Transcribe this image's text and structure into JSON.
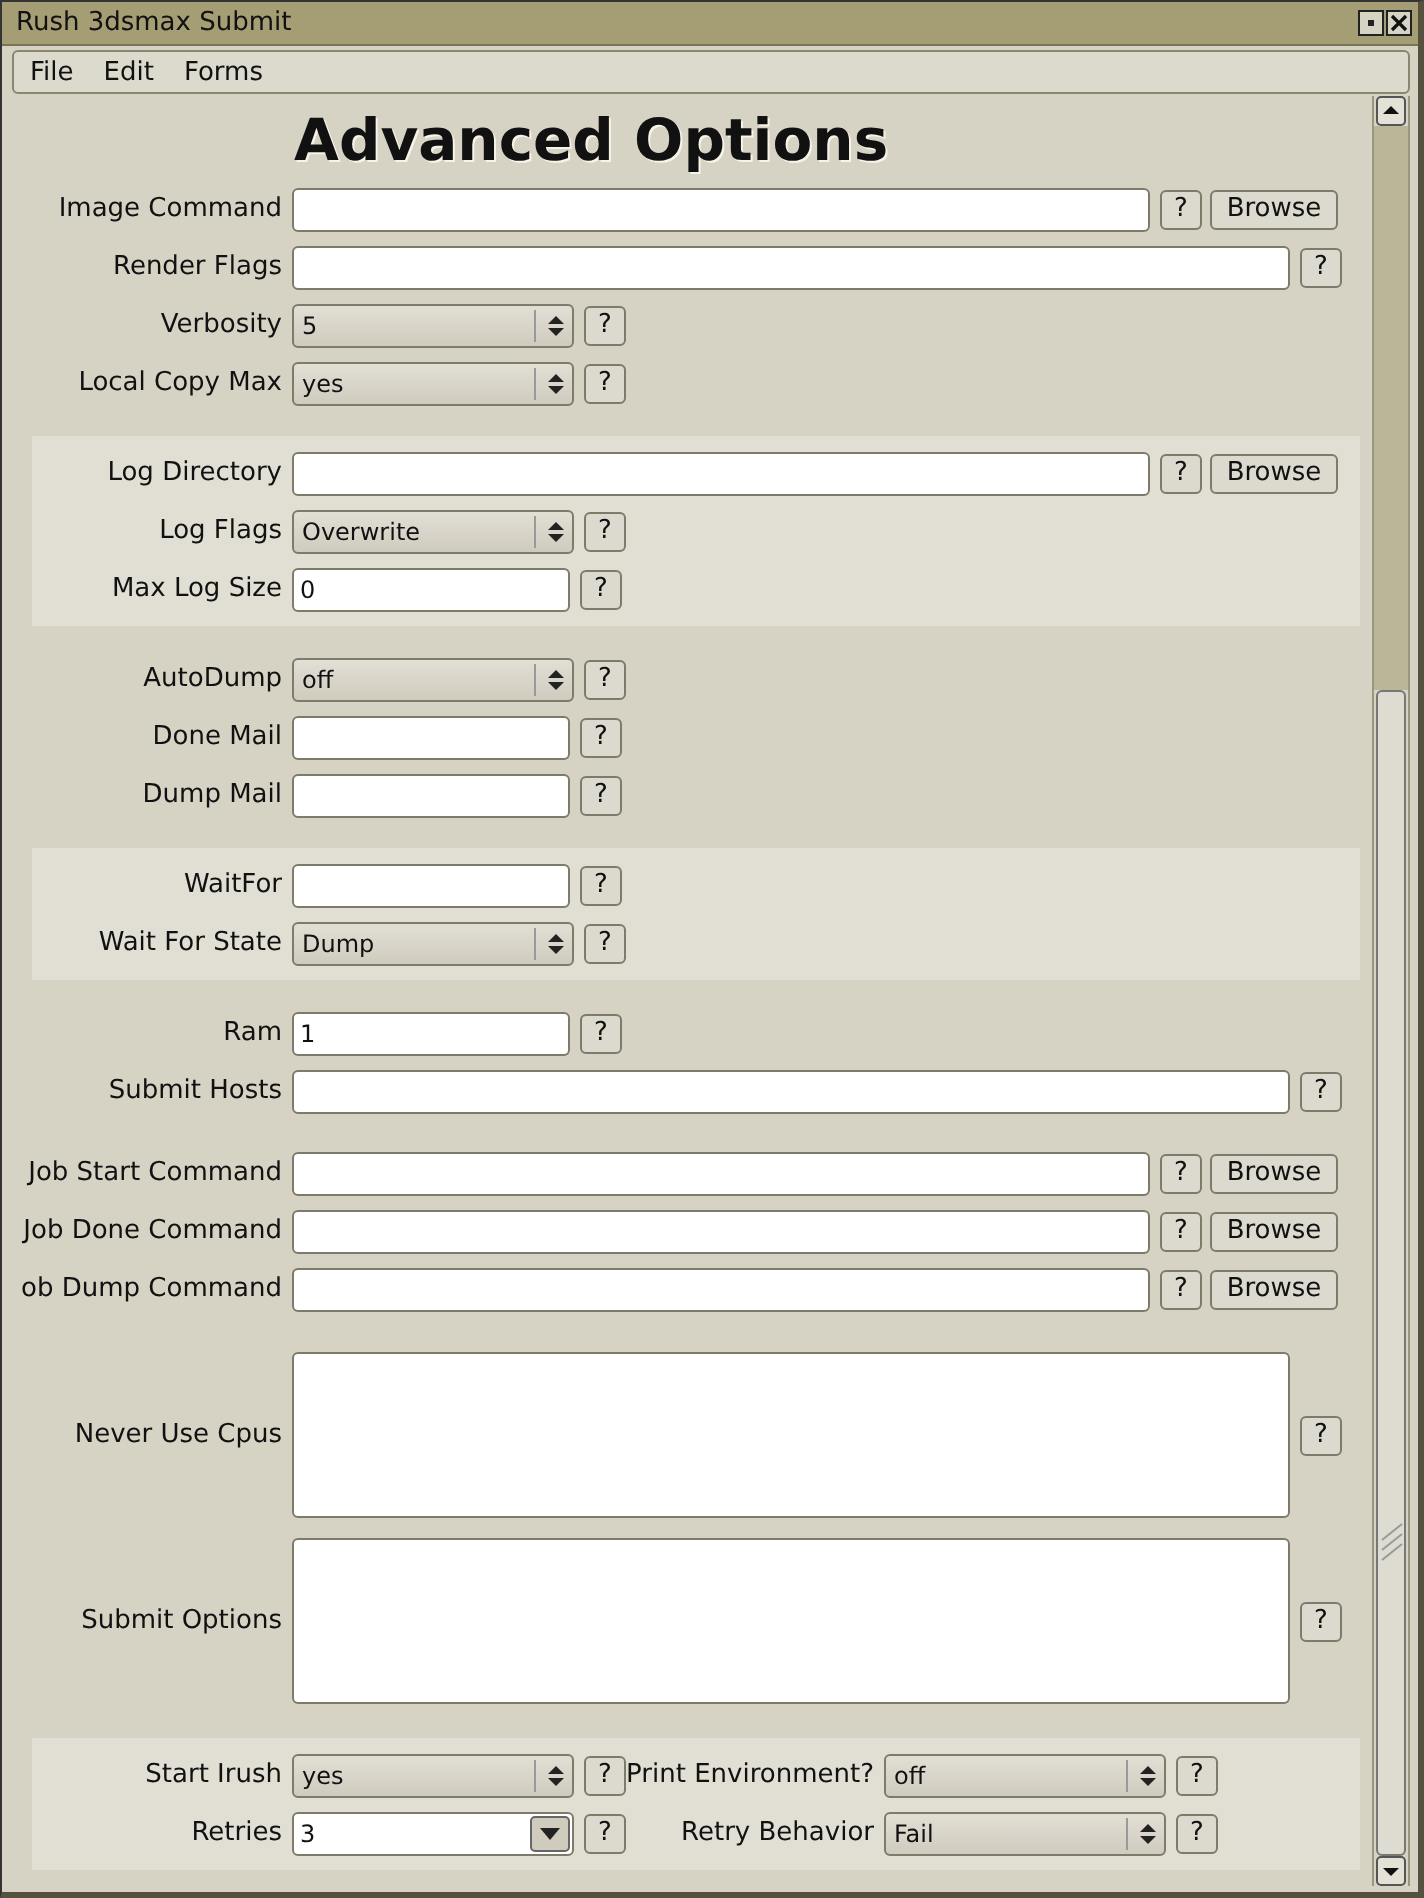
{
  "window": {
    "title": "Rush 3dsmax Submit"
  },
  "menu": [
    {
      "label": "File"
    },
    {
      "label": "Edit"
    },
    {
      "label": "Forms"
    }
  ],
  "heading": "Advanced Options",
  "sections": [
    {
      "shaded": false,
      "rows": [
        {
          "kind": "path",
          "label": "Image Command",
          "help": "?",
          "browse": "Browse"
        },
        {
          "kind": "wide",
          "label": "Render Flags",
          "help": "?"
        },
        {
          "kind": "select",
          "label": "Verbosity",
          "value": "5",
          "help": "?"
        },
        {
          "kind": "select",
          "label": "Local Copy Max",
          "value": "yes",
          "help": "?"
        }
      ]
    },
    {
      "shaded": true,
      "rows": [
        {
          "kind": "path",
          "label": "Log Directory",
          "help": "?",
          "browse": "Browse"
        },
        {
          "kind": "select",
          "label": "Log Flags",
          "value": "Overwrite",
          "help": "?"
        },
        {
          "kind": "text",
          "label": "Max Log Size",
          "value": "0",
          "help": "?"
        }
      ]
    },
    {
      "shaded": false,
      "rows": [
        {
          "kind": "select",
          "label": "AutoDump",
          "value": "off",
          "help": "?"
        },
        {
          "kind": "text",
          "label": "Done Mail",
          "help": "?"
        },
        {
          "kind": "text",
          "label": "Dump Mail",
          "help": "?"
        }
      ]
    },
    {
      "shaded": true,
      "rows": [
        {
          "kind": "text",
          "label": "WaitFor",
          "help": "?"
        },
        {
          "kind": "select",
          "label": "Wait For State",
          "value": "Dump",
          "help": "?"
        }
      ]
    },
    {
      "shaded": false,
      "rows": [
        {
          "kind": "text",
          "label": "Ram",
          "value": "1",
          "help": "?"
        },
        {
          "kind": "wide",
          "label": "Submit Hosts",
          "help": "?"
        }
      ]
    },
    {
      "shaded": false,
      "rows": [
        {
          "kind": "path",
          "label": "Job Start Command",
          "help": "?",
          "browse": "Browse"
        },
        {
          "kind": "path",
          "label": "Job Done Command",
          "help": "?",
          "browse": "Browse"
        },
        {
          "kind": "path",
          "label": "ob Dump Command",
          "help": "?",
          "browse": "Browse"
        }
      ]
    },
    {
      "shaded": false,
      "rows": [
        {
          "kind": "area",
          "label": "Never Use Cpus",
          "help": "?"
        },
        {
          "kind": "area",
          "label": "Submit Options",
          "help": "?"
        }
      ]
    },
    {
      "shaded": true,
      "rows": [
        {
          "kind": "pair",
          "fields": [
            {
              "kind": "select",
              "label": "Start Irush",
              "value": "yes",
              "help": "?"
            },
            {
              "kind": "select",
              "label": "Print Environment?",
              "value": "off",
              "help": "?"
            }
          ]
        },
        {
          "kind": "pair",
          "fields": [
            {
              "kind": "combo",
              "label": "Retries",
              "value": "3",
              "help": "?"
            },
            {
              "kind": "select",
              "label": "Retry Behavior",
              "value": "Fail",
              "help": "?"
            }
          ]
        }
      ]
    }
  ]
}
